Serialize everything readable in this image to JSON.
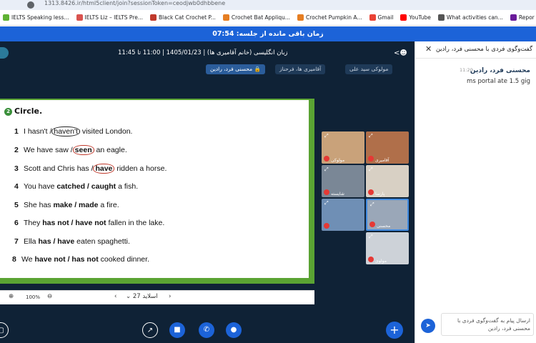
{
  "browser": {
    "url": "1313.8426.ir/html5client/join?sessionToken=ceodjwb0dhbbene",
    "bookmarks": [
      {
        "label": "IELTS Speaking less...",
        "color": "#5fb233"
      },
      {
        "label": "IELTS Liz – IELTS Pre...",
        "color": "#d9534f"
      },
      {
        "label": "Black Cat Crochet P...",
        "color": "#c0392b"
      },
      {
        "label": "Crochet Bat Appliqu...",
        "color": "#e67e22"
      },
      {
        "label": "Crochet Pumpkin A...",
        "color": "#e67e22"
      },
      {
        "label": "Gmail",
        "color": "#ea4335"
      },
      {
        "label": "YouTube",
        "color": "#ff0000"
      },
      {
        "label": "What activities can...",
        "color": "#555555"
      },
      {
        "label": "Repor",
        "color": "#6a1b9a"
      }
    ]
  },
  "timer": "زمان باقی مانده از جلسه: 07:54",
  "meeting": {
    "title": "زبان انگلیسی (خانم آقامیری ها) | 1405/01/23 | 11:00 تا 11:45",
    "chips": [
      "مولوکی سید علی",
      "آقامیری ها، فرحناز",
      "محسنی فرد، رادین"
    ]
  },
  "slide": {
    "heading_num": "2",
    "heading": "Circle.",
    "sentences": [
      {
        "n": "1",
        "pre": "I hasn't /",
        "circ": "haven't",
        "post": " visited London."
      },
      {
        "n": "2",
        "pre": "We have saw /",
        "circ": "seen",
        "post": " an eagle."
      },
      {
        "n": "3",
        "pre": "Scott and Chris has /",
        "circ": "have",
        "post": " ridden a horse."
      },
      {
        "n": "4",
        "pre": "You have ",
        "bold": "catched / caught",
        "post": " a fish."
      },
      {
        "n": "5",
        "pre": "She has ",
        "bold": "make / made",
        "post": " a fire."
      },
      {
        "n": "6",
        "pre": "They ",
        "bold": "has not / have not",
        "post": " fallen in the lake."
      },
      {
        "n": "7",
        "pre": "Ella ",
        "bold": "has / have",
        "post": " eaten spaghetti."
      },
      {
        "n": "8",
        "pre": "We ",
        "bold": "have not / has not",
        "post": " cooked dinner."
      }
    ],
    "zoom": "100%",
    "slide_label": "اسلاید 27"
  },
  "tiles": [
    {
      "name": "مولوکی",
      "color": "#c9a27a"
    },
    {
      "name": "آقامیری",
      "color": "#b06f4a"
    },
    {
      "name": "شایسته",
      "color": "#7a8796"
    },
    {
      "name": "پارسا",
      "color": "#d8d0c4"
    },
    {
      "name": "",
      "color": "#6f8fb5"
    },
    {
      "name": "محسنی",
      "color": "#9aa7b8"
    },
    {
      "name": "مولوی",
      "color": "#cdd2d8"
    }
  ],
  "chat": {
    "title": "گفت‌وگوی فردی با محسنی فرد، رادین",
    "sender": "محسنی فرد، رادین",
    "time": "11:20",
    "message": "ms portal ate 1.5 gig",
    "input_placeholder": "ارسال پیام به گفت‌وگوی فردی با محسنی فرد، رادین"
  },
  "colors": {
    "accent": "#1c63d8",
    "background": "#0f2236",
    "slide_border": "#5aa333"
  }
}
